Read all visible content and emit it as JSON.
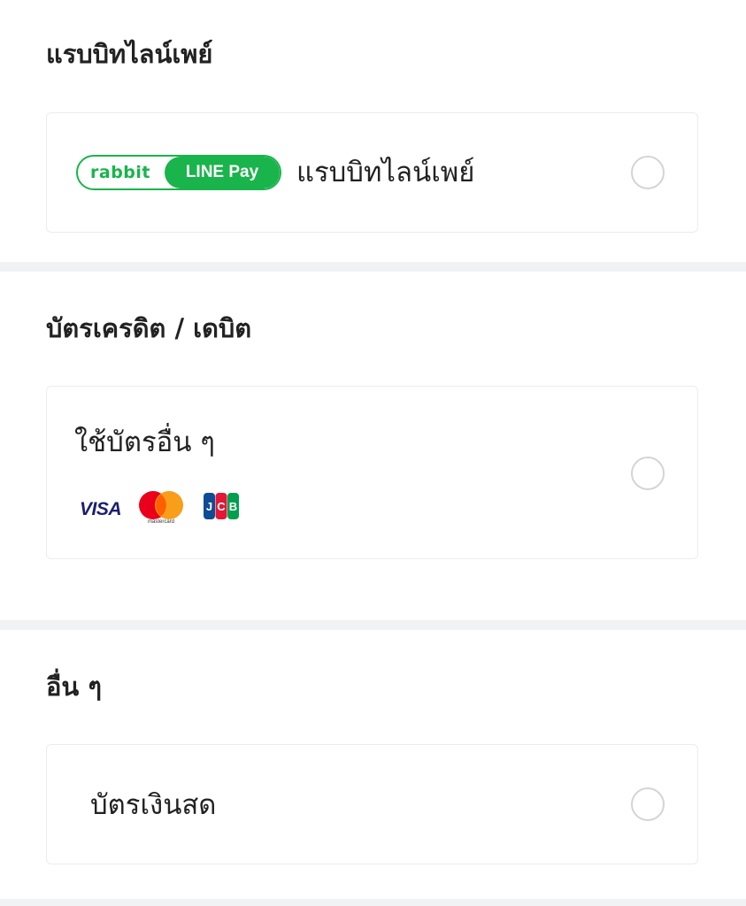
{
  "sections": [
    {
      "title": "แรบบิทไลน์เพย์",
      "options": [
        {
          "label": "แรบบิทไลน์เพย์",
          "logo": {
            "left_text": "rabbit",
            "right_text": "LINE Pay",
            "color": "#19B44B"
          },
          "selected": false
        }
      ]
    },
    {
      "title": "บัตรเครดิต / เดบิต",
      "options": [
        {
          "label": "ใช้บัตรอื่น ๆ",
          "brands": {
            "visa": "VISA",
            "mastercard": "mastercard",
            "jcb": "JCB"
          },
          "selected": false
        }
      ]
    },
    {
      "title": "อื่น ๆ",
      "options": [
        {
          "label": "บัตรเงินสด",
          "selected": false
        }
      ]
    }
  ],
  "colors": {
    "background": "#F1F2F4",
    "card_border": "#ECECEC",
    "radio_border": "#D2D4D7",
    "rabbit_line_pay_green": "#19B44B",
    "visa_blue": "#1A1F71",
    "mastercard_red": "#EB001B",
    "mastercard_orange": "#F79E1B"
  }
}
